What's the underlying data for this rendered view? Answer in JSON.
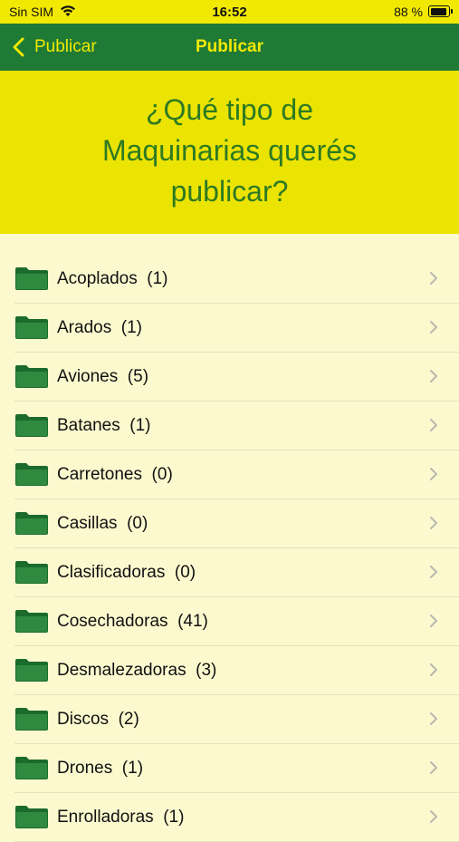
{
  "status": {
    "carrier": "Sin SIM",
    "time": "16:52",
    "battery_pct": "88 %"
  },
  "nav": {
    "back_label": "Publicar",
    "title": "Publicar"
  },
  "header": {
    "question": "¿Qué tipo de Maquinarias querés publicar?"
  },
  "colors": {
    "nav_bg": "#1f7a36",
    "accent_yellow": "#f1e902",
    "header_bg": "#ebe301",
    "heading_green": "#2d7a22",
    "list_bg": "#fdf9cf"
  },
  "list": {
    "icon": "folder-icon",
    "items": [
      {
        "label": "Acoplados  (1)"
      },
      {
        "label": "Arados  (1)"
      },
      {
        "label": "Aviones  (5)"
      },
      {
        "label": "Batanes  (1)"
      },
      {
        "label": "Carretones  (0)"
      },
      {
        "label": "Casillas  (0)"
      },
      {
        "label": "Clasificadoras  (0)"
      },
      {
        "label": "Cosechadoras  (41)"
      },
      {
        "label": "Desmalezadoras  (3)"
      },
      {
        "label": "Discos  (2)"
      },
      {
        "label": "Drones  (1)"
      },
      {
        "label": "Enrolladoras  (1)"
      }
    ]
  }
}
